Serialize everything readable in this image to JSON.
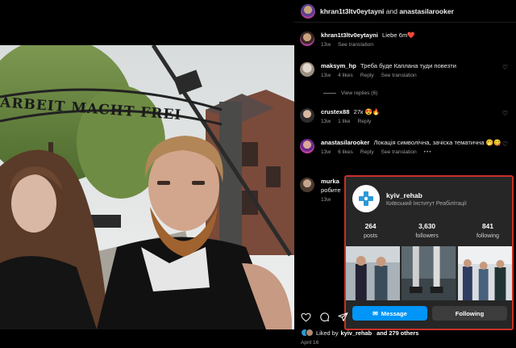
{
  "post": {
    "header": {
      "user1": "khran1t3ltv0eytayni",
      "and_text": "and",
      "user2": "anastasilarooker"
    },
    "photo": {
      "sign_text": "ARBEIT MACHT FREI"
    }
  },
  "comments": [
    {
      "user": "khran1t3ltv0eytayni",
      "text": "Liebe 6m❤️",
      "time": "13w",
      "likes": "",
      "reply": "",
      "translation": "See translation"
    },
    {
      "user": "maksym_hp",
      "text": "Треба буде Каплана туди повезти",
      "time": "13w",
      "likes": "4 likes",
      "reply": "Reply",
      "translation": "See translation"
    },
    {
      "user": "crustex88",
      "text": "27к 😍🔥",
      "time": "13w",
      "likes": "1 like",
      "reply": "Reply",
      "translation": ""
    },
    {
      "user": "anastasilarooker",
      "text": "Локація символічна, зачіска тематична 🤭😋",
      "time": "13w",
      "likes": "6 likes",
      "reply": "Reply",
      "translation": "See translation",
      "more": "•••"
    },
    {
      "user": "murka",
      "text": "робите",
      "time": "13w"
    }
  ],
  "view_replies": "View replies (6)",
  "hover_card": {
    "username": "kyiv_rehab",
    "fullname": "Київський Інститут Реабілітації",
    "stats": [
      {
        "value": "264",
        "label": "posts"
      },
      {
        "value": "3,630",
        "label": "followers"
      },
      {
        "value": "841",
        "label": "following"
      }
    ],
    "message_label": "Message",
    "following_label": "Following",
    "accent_color": "#0095f6",
    "border_color": "#c8302a"
  },
  "likes_line": {
    "prefix": "Liked by",
    "user": "kyiv_rehab",
    "rest": "and 279 others"
  },
  "date": "April 16"
}
